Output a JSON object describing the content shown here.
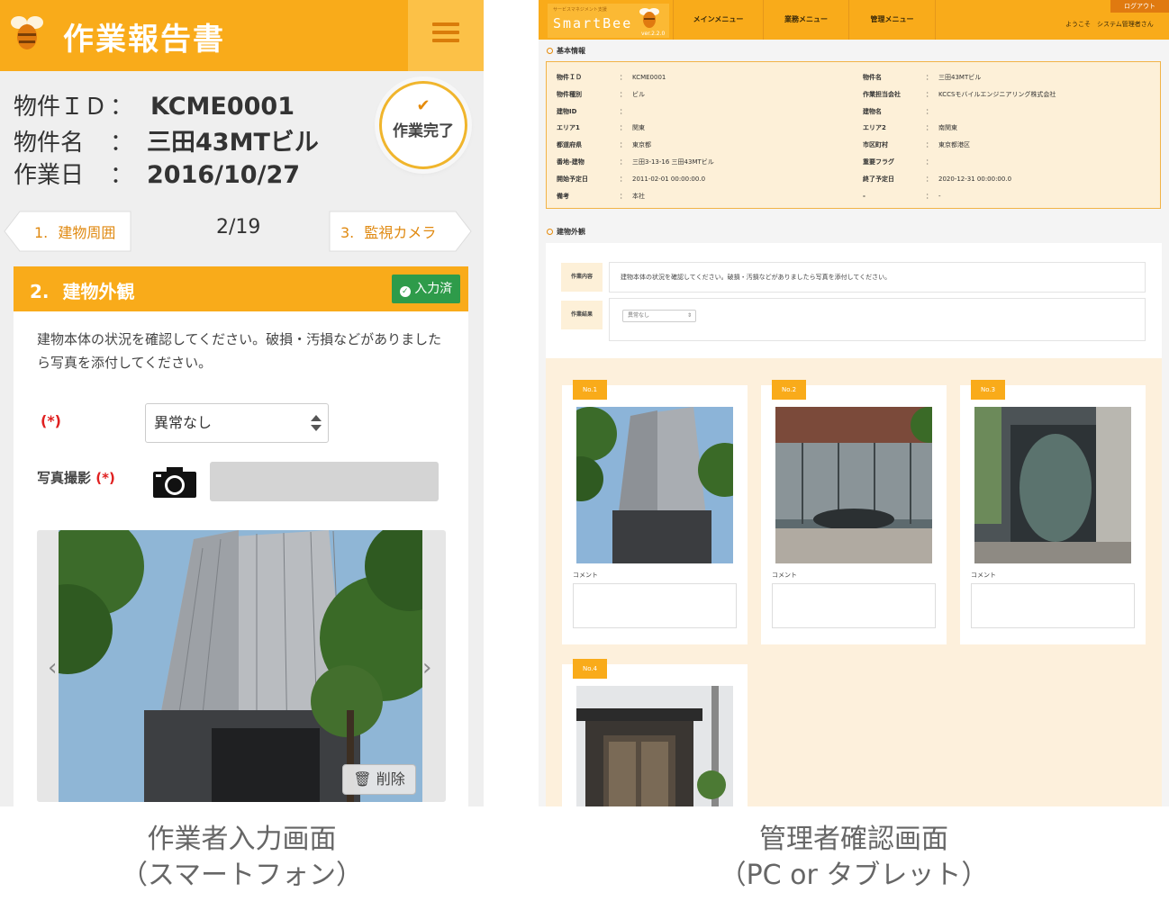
{
  "mobile": {
    "title": "作業報告書",
    "info": [
      {
        "label": "物件ＩＤ",
        "sep": "：",
        "value": "KCME0001"
      },
      {
        "label": "物件名",
        "sep": "：",
        "value": "三田43MTビル"
      },
      {
        "label": "作業日",
        "sep": "：",
        "value": "2016/10/27"
      }
    ],
    "done_badge": {
      "check": "✔",
      "label": "作業完了"
    },
    "prev": {
      "num": "1.",
      "label": "建物周囲"
    },
    "counter": "2/19",
    "next": {
      "num": "3.",
      "label": "監視カメラ"
    },
    "section": {
      "num": "2.",
      "title": "建物外観",
      "status": "入力済"
    },
    "description": "建物本体の状況を確認してください。破損・汚損などがありましたら写真を添付してください。",
    "required_mark": "(*)",
    "result_value": "異常なし",
    "photo_label": "写真撮影",
    "delete_label": "削除"
  },
  "captions": {
    "left_line1": "作業者入力画面",
    "left_line2": "（スマートフォン）",
    "right_line1": "管理者確認画面",
    "right_line2": "（PC or タブレット）"
  },
  "pc": {
    "logo_sub": "サービスマネジメント支援",
    "logo_name": "SmartBee",
    "logo_version": "ver.2.2.0",
    "nav": [
      "メインメニュー",
      "業務メニュー",
      "管理メニュー"
    ],
    "logout": "ログアウト",
    "welcome": "ようこそ　システム管理者さん",
    "basic_title": "基本情報",
    "basic_left": [
      {
        "k": "物件ＩＤ",
        "v": "KCME0001"
      },
      {
        "k": "物件種別",
        "v": "ビル"
      },
      {
        "k": "建物ID",
        "v": ""
      },
      {
        "k": "エリア1",
        "v": "関東"
      },
      {
        "k": "都道府県",
        "v": "東京都"
      },
      {
        "k": "番地-建物",
        "v": "三田3-13-16 三田43MTビル"
      },
      {
        "k": "開始予定日",
        "v": "2011-02-01 00:00:00.0"
      },
      {
        "k": "備考",
        "v": "本社"
      }
    ],
    "basic_right": [
      {
        "k": "物件名",
        "v": "三田43MTビル"
      },
      {
        "k": "作業担当会社",
        "v": "KCCSモバイルエンジニアリング株式会社"
      },
      {
        "k": "建物名",
        "v": ""
      },
      {
        "k": "エリア2",
        "v": "南関東"
      },
      {
        "k": "市区町村",
        "v": "東京都港区"
      },
      {
        "k": "重要フラグ",
        "v": ""
      },
      {
        "k": "終了予定日",
        "v": "2020-12-31 00:00:00.0"
      },
      {
        "k": "-",
        "v": "-"
      }
    ],
    "kv_sep": "：",
    "exterior_title": "建物外観",
    "work_content_label": "作業内容",
    "work_content": "建物本体の状況を確認してください。破損・汚損などがありましたら写真を添付してください。",
    "work_result_label": "作業結果",
    "work_result": "異常なし",
    "photos": [
      {
        "no": "No.1",
        "comment_label": "コメント"
      },
      {
        "no": "No.2",
        "comment_label": "コメント"
      },
      {
        "no": "No.3",
        "comment_label": "コメント"
      },
      {
        "no": "No.4",
        "comment_label": ""
      }
    ]
  }
}
